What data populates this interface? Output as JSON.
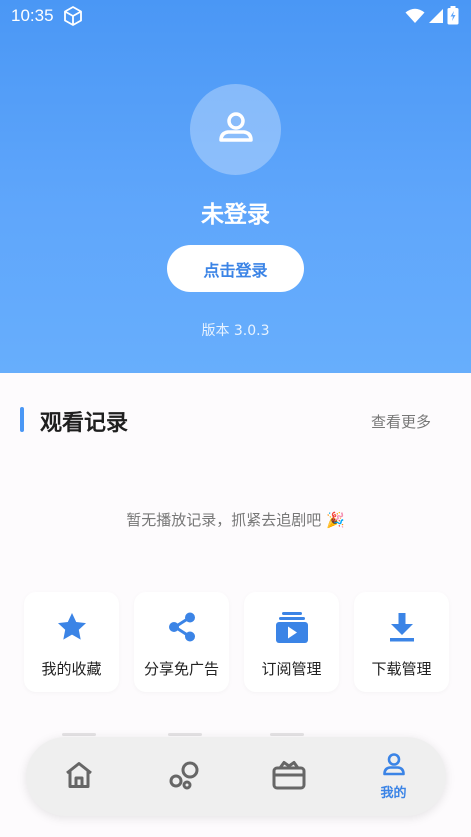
{
  "status_bar": {
    "time": "10:35"
  },
  "profile": {
    "username": "未登录",
    "login_button": "点击登录",
    "version": "版本 3.0.3"
  },
  "history": {
    "title": "观看记录",
    "more": "查看更多",
    "empty": "暂无播放记录，抓紧去追剧吧 🎉"
  },
  "tiles": [
    {
      "label": "我的收藏",
      "icon": "star-icon"
    },
    {
      "label": "分享免广告",
      "icon": "share-icon"
    },
    {
      "label": "订阅管理",
      "icon": "subscription-icon"
    },
    {
      "label": "下载管理",
      "icon": "download-icon"
    }
  ],
  "bottom_nav": {
    "items": [
      {
        "icon": "home-icon",
        "label": ""
      },
      {
        "icon": "bubbles-icon",
        "label": ""
      },
      {
        "icon": "tv-box-icon",
        "label": ""
      },
      {
        "icon": "person-icon",
        "label": "我的",
        "active": true
      }
    ]
  },
  "colors": {
    "accent": "#4a97f5",
    "accent_text": "#3b84e6",
    "header_top": "#4a97f5",
    "header_bottom": "#67aefc"
  }
}
